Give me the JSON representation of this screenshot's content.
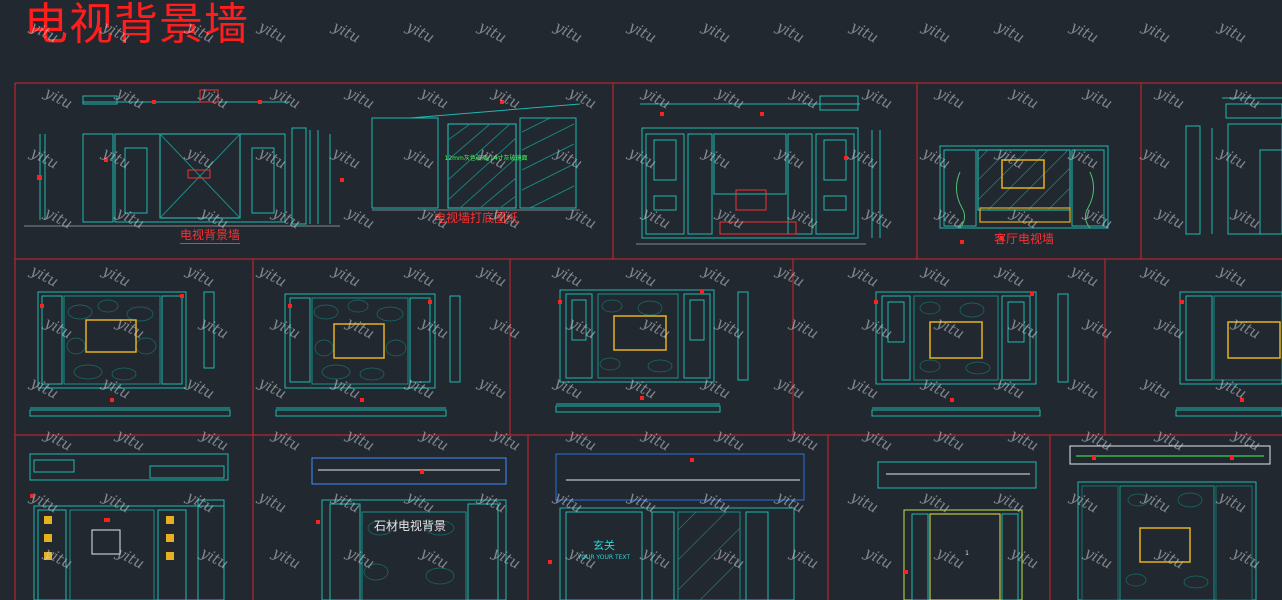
{
  "title": "电视背景墙",
  "watermark": "yitu",
  "labels": {
    "tv_wall": "电视背景墙",
    "tv_wall_base": "电视墙打底图纸",
    "living_room_tv_wall": "客厅电视墙",
    "stone_tv_wall": "石材电视背景",
    "entrance": "玄关",
    "entrance_sub": "YOUR YOUR TEXT",
    "panel_a": "12mm灰色玻璃/14寸灰玻镜面",
    "panel_b": "1"
  },
  "colors": {
    "background": "#212830",
    "frame": "#d9242c",
    "drawing": "#1fb8b0",
    "screen": "#e5b120",
    "accent": "#ff2020",
    "watermark": "#cdd2d7"
  }
}
